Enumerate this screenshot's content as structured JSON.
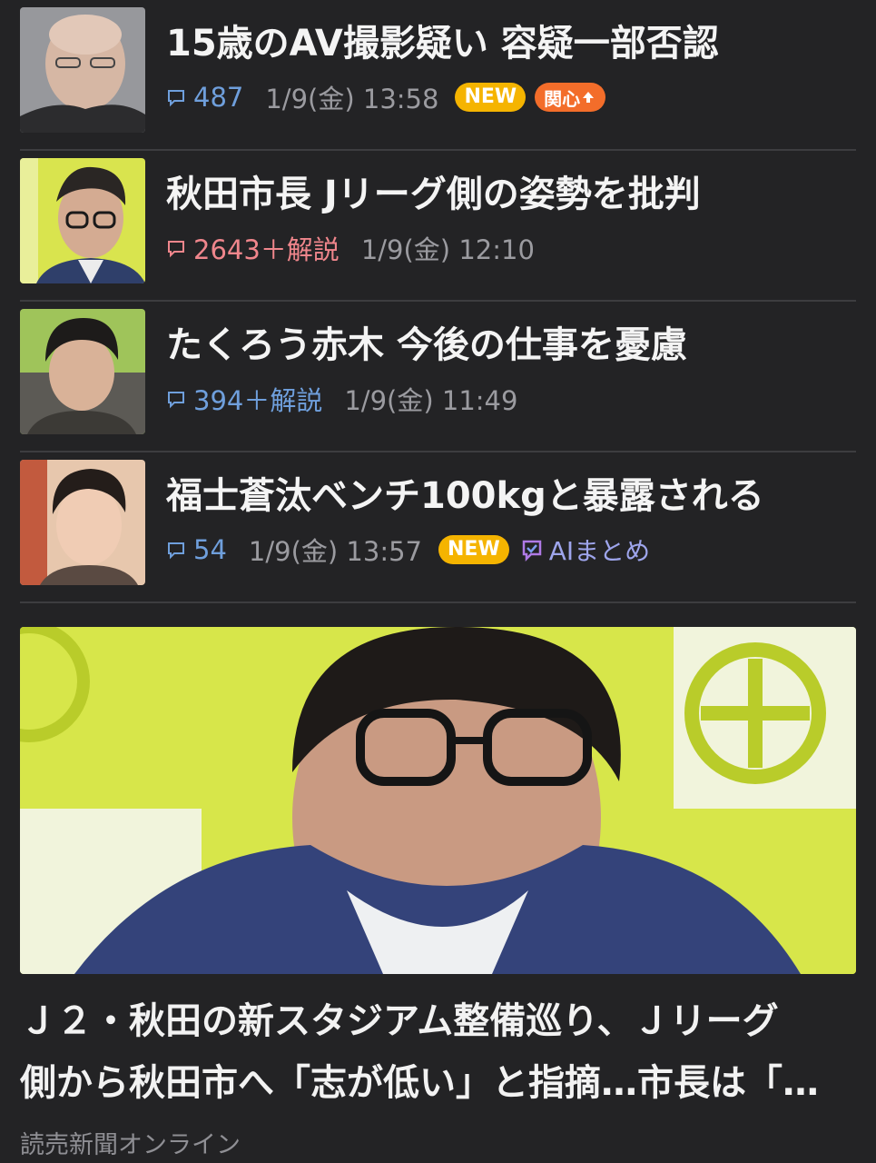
{
  "articles": [
    {
      "title": "15歳のAV撮影疑い 容疑一部否認",
      "comments": "487",
      "hot": false,
      "date": "1/9(金) 13:58",
      "badge_new": "NEW",
      "badge_interest": "関心",
      "ai_summary": ""
    },
    {
      "title": "秋田市長 Jリーグ側の姿勢を批判",
      "comments": "2643＋解説",
      "hot": true,
      "date": "1/9(金) 12:10",
      "badge_new": "",
      "badge_interest": "",
      "ai_summary": ""
    },
    {
      "title": "たくろう赤木 今後の仕事を憂慮",
      "comments": "394＋解説",
      "hot": false,
      "date": "1/9(金) 11:49",
      "badge_new": "",
      "badge_interest": "",
      "ai_summary": ""
    },
    {
      "title": "福士蒼汰ベンチ100kgと暴露される",
      "comments": "54",
      "hot": false,
      "date": "1/9(金) 13:57",
      "badge_new": "NEW",
      "badge_interest": "",
      "ai_summary": "AIまとめ"
    }
  ],
  "hero": {
    "title_line1": "Ｊ２・秋田の新スタジアム整備巡り、Ｊリーグ",
    "title_line2": "側から秋田市へ「志が低い」と指摘…市長は「…",
    "source": "読売新聞オンライン"
  },
  "colors": {
    "background": "#232325",
    "comment_count": "#6f9fdc",
    "comment_count_hot": "#f0868c",
    "badge_new": "#f5b400",
    "badge_interest": "#f36d2a",
    "ai_summary": "#9ea5ec",
    "hero_backdrop": "#d7e64a"
  },
  "icons": {
    "comment": "speech-bubble-icon",
    "interest_arrow": "arrow-up-icon",
    "ai": "ai-check-icon"
  }
}
